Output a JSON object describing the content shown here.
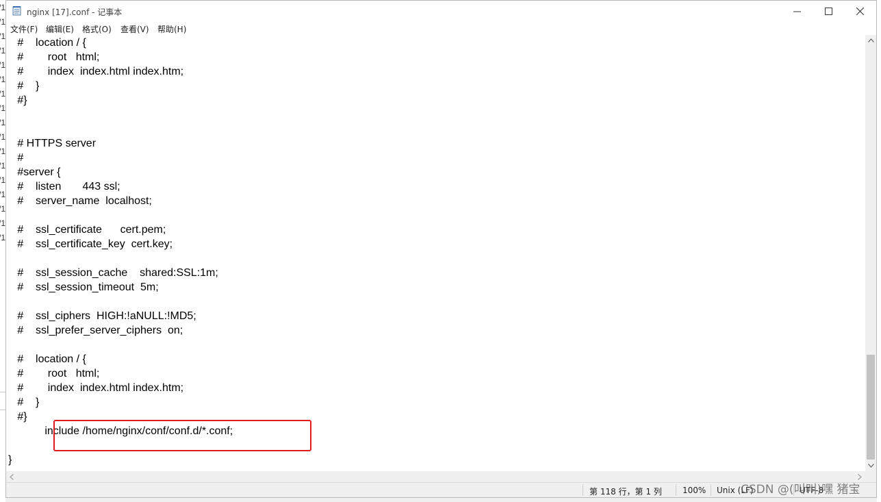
{
  "window": {
    "title": "nginx [17].conf - 记事本",
    "minimize_glyph": "—",
    "maximize_glyph": "☐",
    "close_glyph": "✕",
    "app_icon": "notepad-icon"
  },
  "menu": {
    "items": [
      {
        "label": "文件(F)"
      },
      {
        "label": "编辑(E)"
      },
      {
        "label": "格式(O)"
      },
      {
        "label": "查看(V)"
      },
      {
        "label": "帮助(H)"
      }
    ]
  },
  "editor": {
    "lines": [
      "   #    location / {",
      "   #        root   html;",
      "   #        index  index.html index.htm;",
      "   #    }",
      "   #}",
      "",
      "",
      "   # HTTPS server",
      "   #",
      "   #server {",
      "   #    listen       443 ssl;",
      "   #    server_name  localhost;",
      "",
      "   #    ssl_certificate      cert.pem;",
      "   #    ssl_certificate_key  cert.key;",
      "",
      "   #    ssl_session_cache    shared:SSL:1m;",
      "   #    ssl_session_timeout  5m;",
      "",
      "   #    ssl_ciphers  HIGH:!aNULL:!MD5;",
      "   #    ssl_prefer_server_ciphers  on;",
      "",
      "   #    location / {",
      "   #        root   html;",
      "   #        index  index.html index.htm;",
      "   #    }",
      "   #}",
      "            include /home/nginx/conf/conf.d/*.conf;",
      "",
      "}"
    ]
  },
  "status": {
    "position": "第 118 行，第 1 列",
    "zoom": "100%",
    "line_ending": "Unix (LF)",
    "encoding": "UTF-8"
  },
  "watermark": "CSDN @(叫叫)嘿 猪宝",
  "background_fragments": [
    "/1",
    "/1",
    "/1",
    "/1",
    "/1",
    "/1",
    "/1",
    "/1",
    "/1",
    "/1",
    "/1",
    "/1",
    "/1",
    "/1",
    "/1",
    "/1",
    "/1"
  ],
  "colors": {
    "highlight_border": "#e0191c",
    "scroll_thumb": "#c2c2c2"
  }
}
